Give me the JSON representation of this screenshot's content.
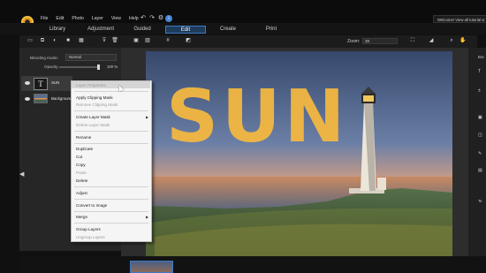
{
  "menu": [
    "File",
    "Edit",
    "Photo",
    "Layer",
    "View",
    "Help"
  ],
  "welcome": "Welcome! View all tutorial vi",
  "modes": [
    "Library",
    "Adjustment",
    "Guided",
    "Edit",
    "Create",
    "Print"
  ],
  "active_mode": "Edit",
  "zoom": {
    "label": "Zoom:",
    "value": "38"
  },
  "layers_panel": {
    "blending_label": "Blending mode:",
    "blending_value": "Normal",
    "opacity_label": "Opacity",
    "opacity_value": "100 %",
    "opacity_fraction": 1.0,
    "layers": [
      {
        "name": "SUN",
        "type": "text",
        "selected": true
      },
      {
        "name": "Background",
        "type": "image",
        "selected": false
      }
    ]
  },
  "canvas": {
    "text_layer": "SUN"
  },
  "context_menu": {
    "items": [
      {
        "label": "Layer Properties",
        "enabled": false,
        "highlighted": true
      },
      {
        "label": "Apply Clipping Mask",
        "enabled": true
      },
      {
        "label": "Remove Clipping Mask",
        "enabled": false
      },
      {
        "label": "Create Layer Mask",
        "enabled": true,
        "submenu": true
      },
      {
        "label": "Delete Layer Mask",
        "enabled": false
      },
      {
        "label": "Rename",
        "enabled": true
      },
      {
        "label": "Duplicate",
        "enabled": true
      },
      {
        "label": "Cut",
        "enabled": true
      },
      {
        "label": "Copy",
        "enabled": true
      },
      {
        "label": "Paste",
        "enabled": false
      },
      {
        "label": "Delete",
        "enabled": true
      },
      {
        "label": "Adjust",
        "enabled": true
      },
      {
        "label": "Convert to Image",
        "enabled": true
      },
      {
        "label": "Merge",
        "enabled": true,
        "submenu": true
      },
      {
        "label": "Group Layers",
        "enabled": true
      },
      {
        "label": "Ungroup Layers",
        "enabled": false
      }
    ]
  },
  "right_panel": {
    "labels": [
      "Bra",
      "Te"
    ]
  },
  "colors": {
    "accent": "#3d79c4",
    "text_fill": "#f6b93f",
    "logo": "#e39a1d"
  }
}
